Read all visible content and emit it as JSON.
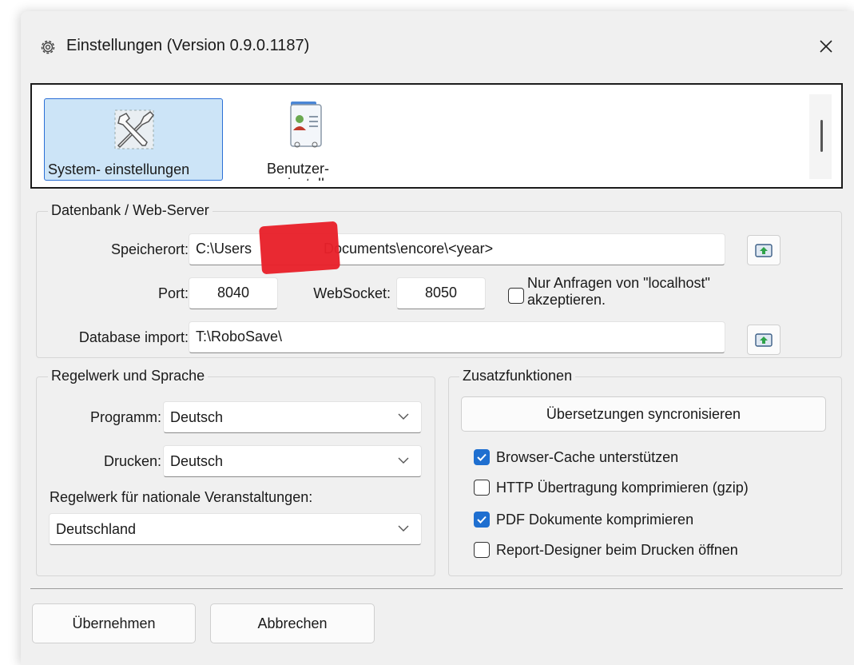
{
  "window": {
    "title": "Einstellungen (Version 0.9.0.1187)",
    "icon": "gear-icon",
    "close_icon": "close-icon"
  },
  "categories": [
    {
      "label": "System- einstellungen",
      "icon": "wrench-screwdriver-icon",
      "selected": true
    },
    {
      "label": "Benutzer-",
      "label_cut": "einstellungen",
      "icon": "user-card-icon",
      "selected": false
    }
  ],
  "db": {
    "group_title": "Datenbank / Web-Server",
    "speicherort_label": "Speicherort:",
    "speicherort_value_prefix": "C:\\Users",
    "speicherort_value_suffix": "Documents\\encore\\<year>",
    "port_label": "Port:",
    "port_value": "8040",
    "websocket_label": "WebSocket:",
    "websocket_value": "8050",
    "localhost_label_line1": "Nur Anfragen von \"localhost\"",
    "localhost_label_line2": "akzeptieren.",
    "localhost_checked": false,
    "import_label": "Database import:",
    "import_value": "T:\\RoboSave\\"
  },
  "rules": {
    "group_title": "Regelwerk und Sprache",
    "programm_label": "Programm:",
    "programm_value": "Deutsch",
    "drucken_label": "Drucken:",
    "drucken_value": "Deutsch",
    "national_label": "Regelwerk für nationale Veranstaltungen:",
    "national_value": "Deutschland"
  },
  "extras": {
    "group_title": "Zusatzfunktionen",
    "sync_button": "Übersetzungen syncronisieren",
    "options": [
      {
        "label": "Browser-Cache unterstützen",
        "checked": true
      },
      {
        "label": "HTTP Übertragung komprimieren (gzip)",
        "checked": false
      },
      {
        "label": "PDF Dokumente komprimieren",
        "checked": true
      },
      {
        "label": "Report-Designer beim Drucken öffnen",
        "checked": false
      }
    ]
  },
  "footer": {
    "apply_label": "Übernehmen",
    "cancel_label": "Abbrechen"
  },
  "colors": {
    "accent": "#1f6fd0",
    "selection": "#cce4f7",
    "redaction": "#e8202a"
  }
}
